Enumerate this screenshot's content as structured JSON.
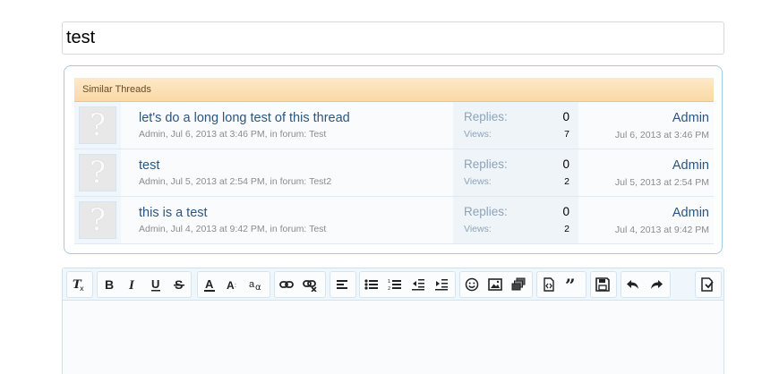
{
  "title_input": {
    "value": "test"
  },
  "similar": {
    "heading": "Similar Threads",
    "replies_label": "Replies:",
    "views_label": "Views:",
    "threads": [
      {
        "title": "let's do a long long test of this thread",
        "meta": "Admin, Jul 6, 2013 at 3:46 PM, in forum: Test",
        "replies": "0",
        "views": "7",
        "last_user": "Admin",
        "last_date": "Jul 6, 2013 at 3:46 PM"
      },
      {
        "title": "test",
        "meta": "Admin, Jul 5, 2013 at 2:54 PM, in forum: Test2",
        "replies": "0",
        "views": "2",
        "last_user": "Admin",
        "last_date": "Jul 5, 2013 at 2:54 PM"
      },
      {
        "title": "this is a test",
        "meta": "Admin, Jul 4, 2013 at 9:42 PM, in forum: Test",
        "replies": "0",
        "views": "2",
        "last_user": "Admin",
        "last_date": "Jul 4, 2013 at 9:42 PM"
      }
    ]
  },
  "toolbar": {
    "icons": [
      "remove-format-icon",
      "bold-icon",
      "italic-icon",
      "underline-icon",
      "strikethrough-icon",
      "text-color-icon",
      "font-size-icon",
      "font-family-icon",
      "link-icon",
      "unlink-icon",
      "align-icon",
      "bullet-list-icon",
      "numbered-list-icon",
      "outdent-icon",
      "indent-icon",
      "smilies-icon",
      "image-icon",
      "media-icon",
      "code-icon",
      "quote-icon",
      "save-draft-icon",
      "undo-icon",
      "redo-icon",
      "toggle-bbcode-icon"
    ]
  },
  "colors": {
    "link": "#2b5680",
    "muted": "#8c8c8c",
    "header_bg": "#fad9a6",
    "border": "#a5cae4"
  }
}
